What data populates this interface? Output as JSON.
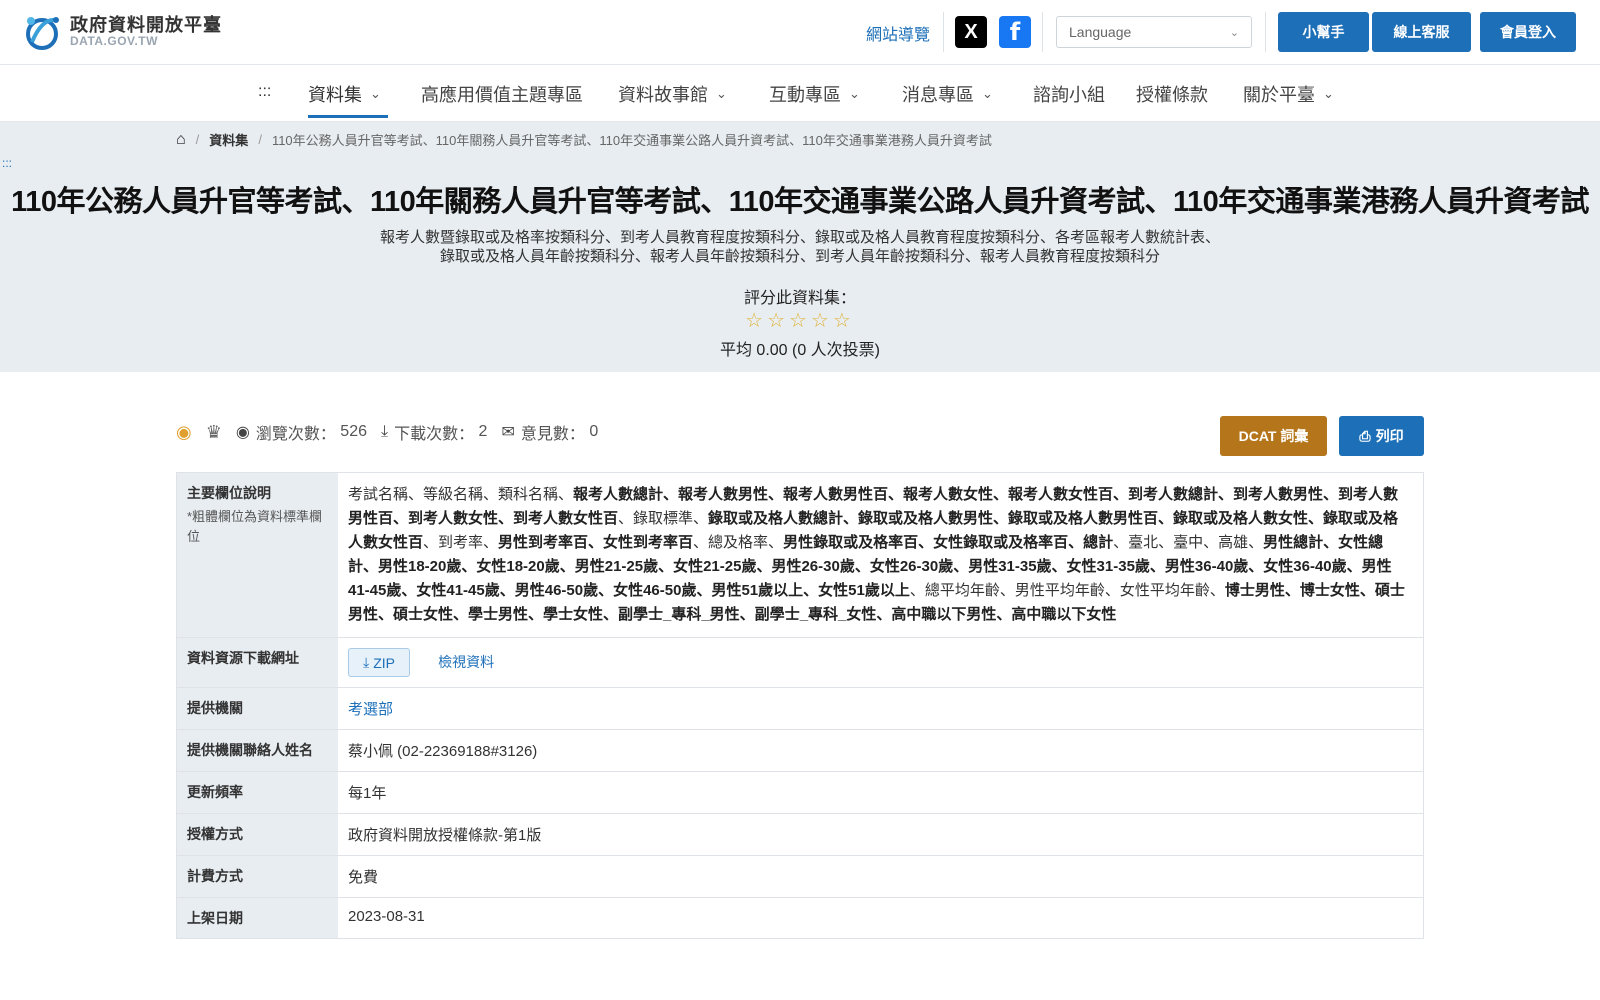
{
  "header": {
    "logo_title": "政府資料開放平臺",
    "logo_sub": "DATA.GOV.TW",
    "sitemap": "網站導覽",
    "social_x": "X",
    "social_fb": "f",
    "language_placeholder": "Language",
    "buttons": [
      "小幫手",
      "線上客服",
      "會員登入"
    ]
  },
  "nav": {
    "dots": ":::",
    "items": [
      "資料集",
      "高應用價值主題專區",
      "資料故事館",
      "互動專區",
      "消息專區",
      "諮詢小組",
      "授權條款",
      "關於平臺"
    ]
  },
  "breadcrumb": {
    "level1": "資料集",
    "current": "110年公務人員升官等考試、110年關務人員升官等考試、110年交通事業公路人員升資考試、110年交通事業港務人員升資考試"
  },
  "hero": {
    "dots": ":::",
    "title": "110年公務人員升官等考試、110年關務人員升官等考試、110年交通事業公路人員升資考試、110年交通事業港務人員升資考試",
    "description": "報考人數暨錄取或及格率按類科分、到考人員教育程度按類科分、錄取或及格人員教育程度按類科分、各考區報考人數統計表、錄取或及格人員年齡按類科分、報考人員年齡按類科分、到考人員年齡按類科分、報考人員教育程度按類科分",
    "rate_label": "評分此資料集：",
    "stars": "☆☆☆☆☆",
    "average": "平均 0.00 (0 人次投票)"
  },
  "stats": {
    "views_label": "瀏覽次數：",
    "views": "526",
    "downloads_label": "下載次數：",
    "downloads": "2",
    "comments_label": "意見數：",
    "comments": "0"
  },
  "actions": {
    "dcat": "DCAT 詞彙",
    "print": "列印"
  },
  "meta": {
    "fields_label": "主要欄位說明",
    "fields_note": "*粗體欄位為資料標準欄位",
    "download_label": "資料資源下載網址",
    "zip": "ZIP",
    "view_data": "檢視資料",
    "provider_label": "提供機關",
    "provider": "考選部",
    "contact_label": "提供機關聯絡人姓名",
    "contact": "蔡小佩 (02-22369188#3126)",
    "frequency_label": "更新頻率",
    "frequency": "每1年",
    "license_label": "授權方式",
    "license": "政府資料開放授權條款-第1版",
    "fee_label": "計費方式",
    "fee": "免費",
    "date_label": "上架日期",
    "date": "2023-08-31"
  },
  "field_segments": [
    {
      "t": "考試名稱、等級名稱、類科名稱、",
      "b": false
    },
    {
      "t": "報考人數總計、報考人數男性、報考人數男性百、報考人數女性、報考人數女性百、到考人數總計、到考人數男性、到考人數男性百、到考人數女性、到考人數女性百",
      "b": true
    },
    {
      "t": "、錄取標準、",
      "b": false
    },
    {
      "t": "錄取或及格人數總計、錄取或及格人數男性、錄取或及格人數男性百、錄取或及格人數女性、錄取或及格人數女性百",
      "b": true
    },
    {
      "t": "、到考率、",
      "b": false
    },
    {
      "t": "男性到考率百、女性到考率百",
      "b": true
    },
    {
      "t": "、總及格率、",
      "b": false
    },
    {
      "t": "男性錄取或及格率百、女性錄取或及格率百、總計",
      "b": true
    },
    {
      "t": "、臺北、臺中、高雄、",
      "b": false
    },
    {
      "t": "男性總計、女性總計、男性18-20歲、女性18-20歲、男性21-25歲、女性21-25歲、男性26-30歲、女性26-30歲、男性31-35歲、女性31-35歲、男性36-40歲、女性36-40歲、男性41-45歲、女性41-45歲、男性46-50歲、女性46-50歲、男性51歲以上、女性51歲以上",
      "b": true
    },
    {
      "t": "、總平均年齡、男性平均年齡、女性平均年齡、",
      "b": false
    },
    {
      "t": "博士男性、博士女性、碩士男性、碩士女性、學士男性、學士女性、副學士_專科_男性、副學士_專科_女性、高中職以下男性、高中職以下女性",
      "b": true
    }
  ],
  "colors": {
    "primary": "#1d6fb8",
    "dcat": "#b5751a",
    "hero_bg": "#e8edf1",
    "star": "#e0b43a"
  }
}
